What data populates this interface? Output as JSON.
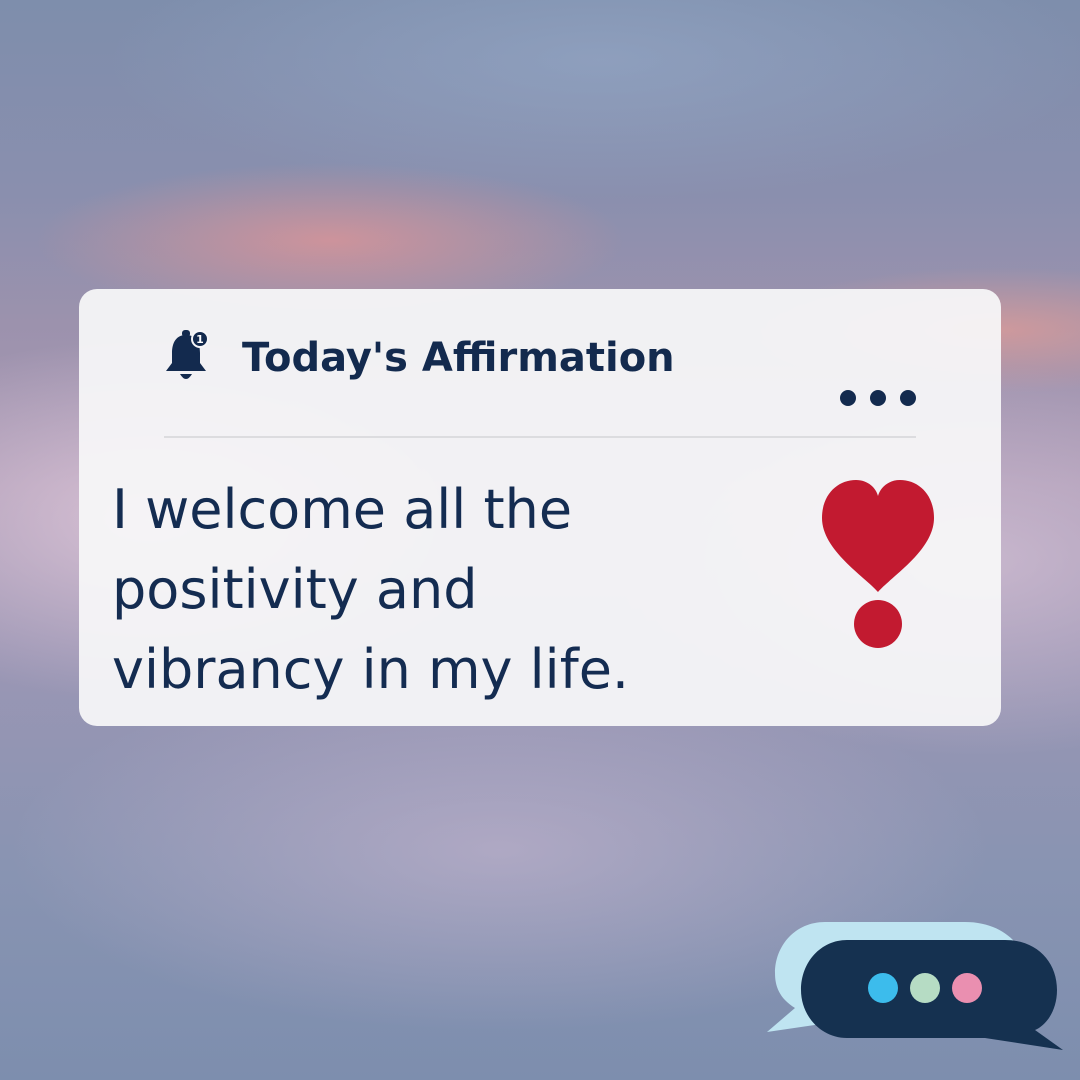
{
  "card": {
    "title": "Today's Affirmation",
    "notification_count": "1",
    "affirmation_lines": [
      "I welcome all the",
      "positivity and",
      "vibrancy in my life."
    ]
  },
  "icons": {
    "bell": "bell-icon",
    "more": "more-options-icon",
    "heart": "heart-exclamation-icon",
    "chat": "chat-bubbles-icon"
  },
  "colors": {
    "text": "#142c51",
    "heart": "#c21a30",
    "chat_dark": "#153150",
    "chat_light": "#bfe4f1",
    "dot_blue": "#3cbcec",
    "dot_green": "#b6dcc4",
    "dot_pink": "#ea8fb0"
  }
}
